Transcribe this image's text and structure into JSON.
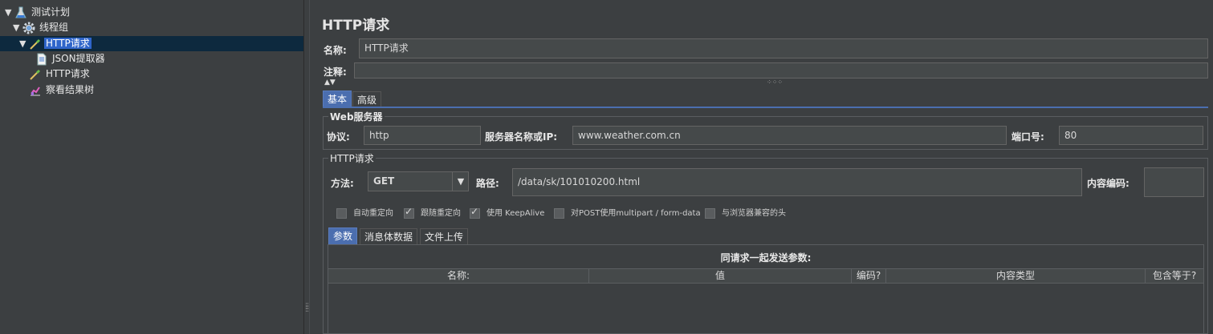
{
  "tree": {
    "items": [
      {
        "label": "测试计划",
        "icon": "flask-icon"
      },
      {
        "label": "线程组",
        "icon": "gear-icon"
      },
      {
        "label": "HTTP请求",
        "icon": "pipette-icon"
      },
      {
        "label": "JSON提取器",
        "icon": "document-icon"
      },
      {
        "label": "HTTP请求",
        "icon": "pipette-icon"
      },
      {
        "label": "察看结果树",
        "icon": "graph-icon"
      }
    ]
  },
  "panel": {
    "title": "HTTP请求",
    "name_label": "名称:",
    "name_value": "HTTP请求",
    "comment_label": "注释:",
    "comment_value": "",
    "tabs": [
      "基本",
      "高级"
    ],
    "web_server": {
      "group_title": "Web服务器",
      "protocol_label": "协议:",
      "protocol_value": "http",
      "server_label": "服务器名称或IP:",
      "server_value": "www.weather.com.cn",
      "port_label": "端口号:",
      "port_value": "80"
    },
    "http_request": {
      "group_title": "HTTP请求",
      "method_label": "方法:",
      "method_value": "GET",
      "path_label": "路径:",
      "path_value": "/data/sk/101010200.html",
      "encoding_label": "内容编码:",
      "encoding_value": ""
    },
    "options": [
      {
        "label": "自动重定向",
        "checked": false
      },
      {
        "label": "跟随重定向",
        "checked": true
      },
      {
        "label": "使用 KeepAlive",
        "checked": true
      },
      {
        "label": "对POST使用multipart / form-data",
        "checked": false
      },
      {
        "label": "与浏览器兼容的头",
        "checked": false
      }
    ],
    "sub_tabs": [
      "参数",
      "消息体数据",
      "文件上传"
    ],
    "params_caption": "同请求一起发送参数:",
    "columns": [
      "名称:",
      "值",
      "编码?",
      "内容类型",
      "包含等于?"
    ]
  }
}
